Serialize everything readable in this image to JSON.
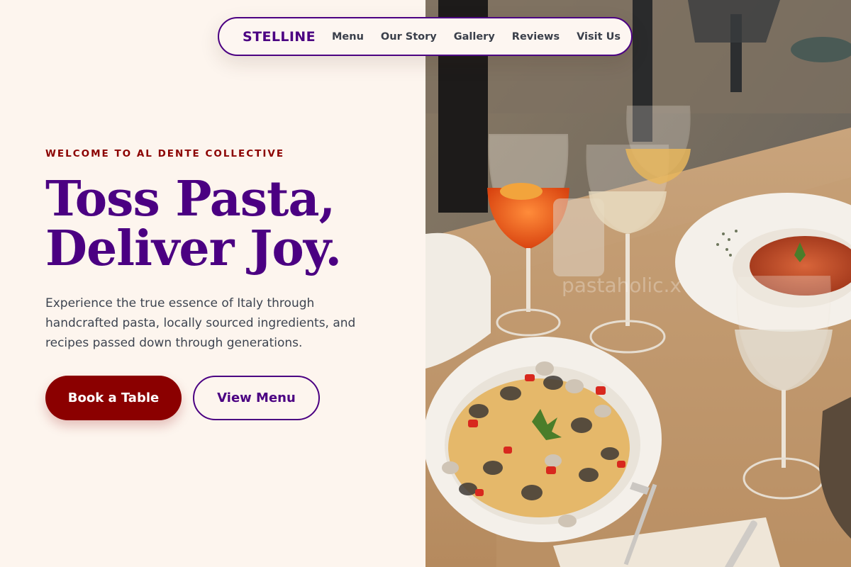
{
  "nav": {
    "brand": "STELLINE",
    "links": [
      "Menu",
      "Our Story",
      "Gallery",
      "Reviews",
      "Visit Us"
    ]
  },
  "hero": {
    "eyebrow": "WELCOME TO AL DENTE COLLECTIVE",
    "headline_line1": "Toss Pasta,",
    "headline_line2": "Deliver Joy.",
    "intro": "Experience the true essence of Italy through handcrafted pasta, locally sourced ingredients, and recipes passed down through generations.",
    "primary_button": "Book a Table",
    "secondary_button": "View Menu"
  },
  "photo": {
    "watermark": "pastaholic.x"
  },
  "colors": {
    "brand_purple": "#4b0082",
    "accent_red": "#8b0000",
    "page_background": "#fdf5ee",
    "body_text": "#3d4450"
  }
}
